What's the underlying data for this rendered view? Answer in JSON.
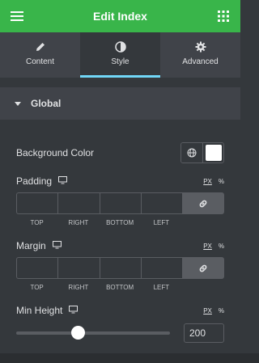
{
  "header": {
    "title": "Edit Index",
    "menu_icon": "hamburger-icon",
    "grid_icon": "grid-icon",
    "bg": "#39b54a"
  },
  "tabs": [
    {
      "label": "Content",
      "icon": "pencil-icon",
      "active": false
    },
    {
      "label": "Style",
      "icon": "contrast-icon",
      "active": true
    },
    {
      "label": "Advanced",
      "icon": "gear-icon",
      "active": false
    }
  ],
  "section": {
    "title": "Global"
  },
  "background": {
    "label": "Background Color",
    "value": "#ffffff"
  },
  "padding": {
    "label": "Padding",
    "unit_px": "PX",
    "unit_pct": "%",
    "labels": [
      "TOP",
      "RIGHT",
      "BOTTOM",
      "LEFT"
    ]
  },
  "margin": {
    "label": "Margin",
    "unit_px": "PX",
    "unit_pct": "%",
    "labels": [
      "TOP",
      "RIGHT",
      "BOTTOM",
      "LEFT"
    ]
  },
  "min_height": {
    "label": "Min Height",
    "unit_px": "PX",
    "unit_pct": "%",
    "value": "200",
    "slider_fraction": 0.4
  },
  "accent": "#71d7f7"
}
